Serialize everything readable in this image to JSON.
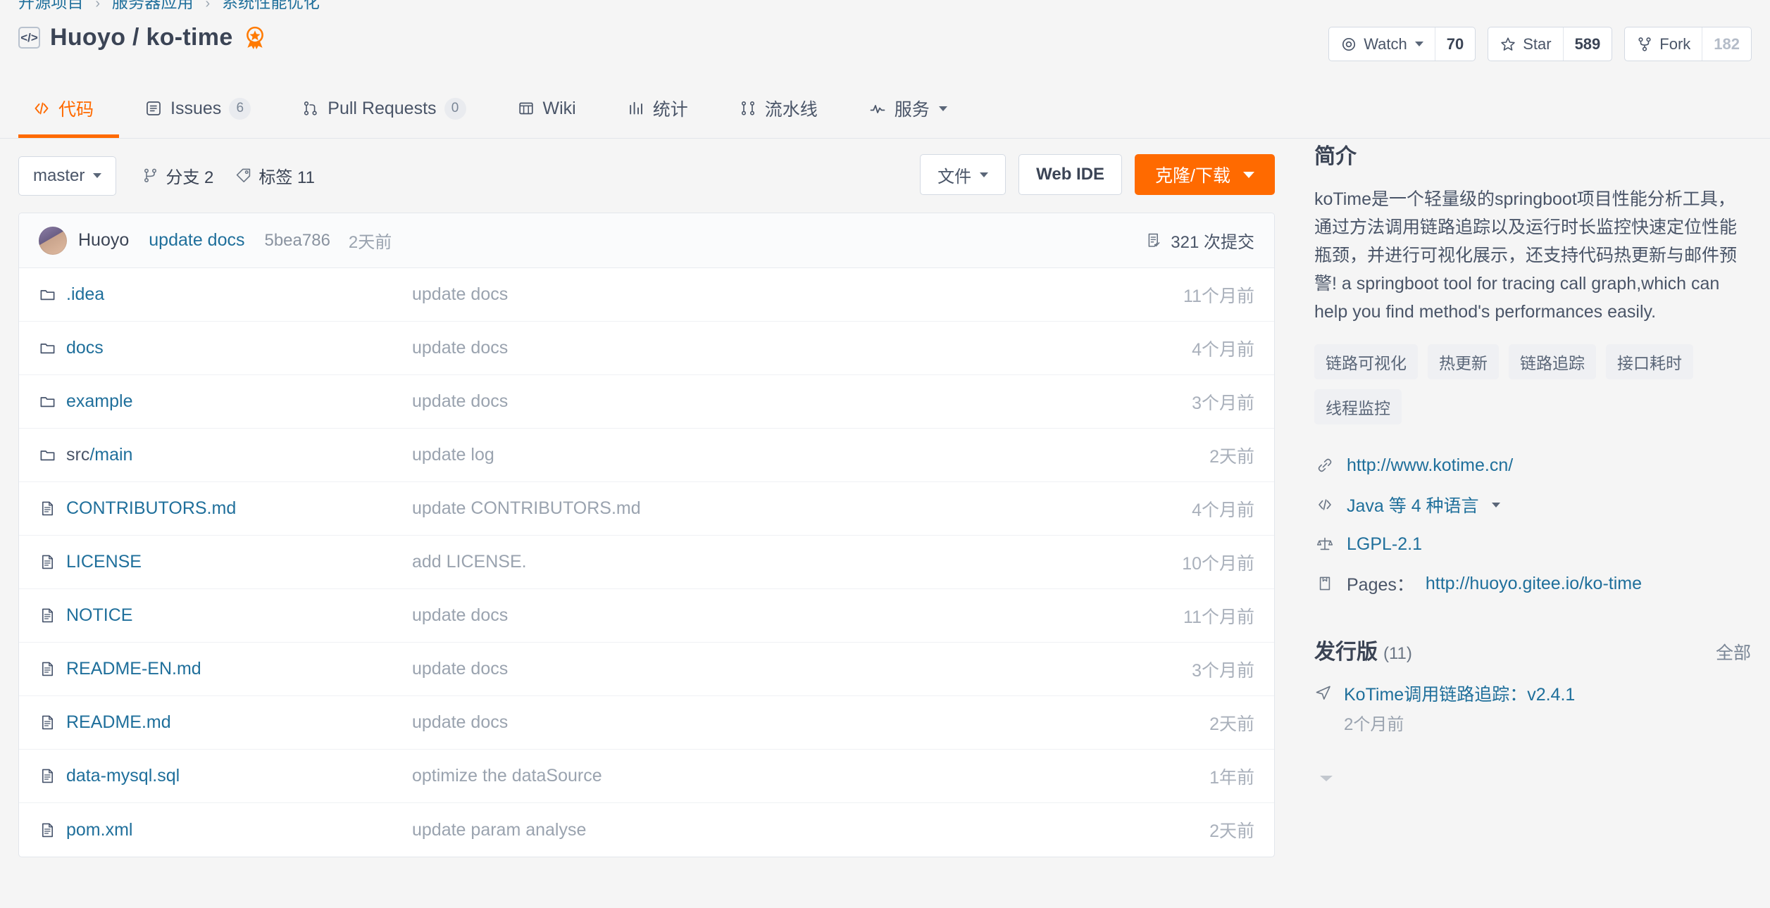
{
  "breadcrumb": {
    "items": [
      "开源项目",
      "服务器应用",
      "系统性能优化"
    ],
    "separator": "›"
  },
  "repo": {
    "owner": "Huoyo",
    "separator": "/",
    "name": "ko-time",
    "code_icon": "code-brackets-icon",
    "medal_icon": "gvp-medal-icon"
  },
  "counters": {
    "watch": {
      "label": "Watch",
      "value": "70",
      "icon": "eye-icon"
    },
    "star": {
      "label": "Star",
      "value": "589",
      "icon": "star-outline-icon"
    },
    "fork": {
      "label": "Fork",
      "value": "182",
      "icon": "fork-icon"
    }
  },
  "nav": {
    "tabs": [
      {
        "label": "代码",
        "icon": "code-icon",
        "badge": null,
        "active": true
      },
      {
        "label": "Issues",
        "icon": "issues-icon",
        "badge": "6",
        "active": false
      },
      {
        "label": "Pull Requests",
        "icon": "pr-icon",
        "badge": "0",
        "active": false
      },
      {
        "label": "Wiki",
        "icon": "book-icon",
        "badge": null,
        "active": false
      },
      {
        "label": "统计",
        "icon": "chart-icon",
        "badge": null,
        "active": false
      },
      {
        "label": "流水线",
        "icon": "pipeline-icon",
        "badge": null,
        "active": false
      },
      {
        "label": "服务",
        "icon": "service-icon",
        "badge": null,
        "active": false,
        "caret": true
      }
    ]
  },
  "toolbar": {
    "branch": "master",
    "branches_label": "分支 2",
    "tags_label": "标签 11",
    "branch_icon": "branch-icon",
    "tag_icon": "tag-icon",
    "files_btn": "文件",
    "webide_btn": "Web IDE",
    "clone_btn": "克隆/下载"
  },
  "commit_bar": {
    "author": "Huoyo",
    "message": "update docs",
    "sha": "5bea786",
    "when": "2天前",
    "commit_count": "321 次提交",
    "commit_icon": "commit-list-icon",
    "avatar_name": "avatar"
  },
  "files": [
    {
      "name": ".idea",
      "name_prefix": "",
      "type": "folder",
      "icon": "folder-icon",
      "message": "update docs",
      "time": "11个月前"
    },
    {
      "name": "docs",
      "name_prefix": "",
      "type": "folder",
      "icon": "folder-icon",
      "message": "update docs",
      "time": "4个月前"
    },
    {
      "name": "example",
      "name_prefix": "",
      "type": "folder",
      "icon": "folder-icon",
      "message": "update docs",
      "time": "3个月前"
    },
    {
      "name": "/main",
      "name_prefix": "src",
      "type": "folder",
      "icon": "folder-icon",
      "message": "update log",
      "time": "2天前"
    },
    {
      "name": "CONTRIBUTORS.md",
      "name_prefix": "",
      "type": "file",
      "icon": "document-icon",
      "message": "update CONTRIBUTORS.md",
      "time": "4个月前"
    },
    {
      "name": "LICENSE",
      "name_prefix": "",
      "type": "file",
      "icon": "document-icon",
      "message": "add LICENSE.",
      "time": "10个月前"
    },
    {
      "name": "NOTICE",
      "name_prefix": "",
      "type": "file",
      "icon": "document-icon",
      "message": "update docs",
      "time": "11个月前"
    },
    {
      "name": "README-EN.md",
      "name_prefix": "",
      "type": "file",
      "icon": "document-icon",
      "message": "update docs",
      "time": "3个月前"
    },
    {
      "name": "README.md",
      "name_prefix": "",
      "type": "file",
      "icon": "document-icon",
      "message": "update docs",
      "time": "2天前"
    },
    {
      "name": "data-mysql.sql",
      "name_prefix": "",
      "type": "file",
      "icon": "document-icon",
      "message": "optimize the dataSource",
      "time": "1年前"
    },
    {
      "name": "pom.xml",
      "name_prefix": "",
      "type": "file",
      "icon": "document-icon",
      "message": "update param analyse",
      "time": "2天前"
    }
  ],
  "sidebar": {
    "intro_heading": "简介",
    "description": "koTime是一个轻量级的springboot项目性能分析工具，通过方法调用链路追踪以及运行时长监控快速定位性能瓶颈，并进行可视化展示，还支持代码热更新与邮件预警! a springboot tool for tracing call graph,which can help you find method's performances easily.",
    "tags": [
      "链路可视化",
      "热更新",
      "链路追踪",
      "接口耗时",
      "线程监控"
    ],
    "homepage": {
      "url": "http://www.kotime.cn/",
      "icon": "link-icon"
    },
    "language": {
      "text": "Java 等 4 种语言",
      "icon": "code-brackets-icon",
      "caret": true
    },
    "license": {
      "text": "LGPL-2.1",
      "icon": "scale-icon"
    },
    "pages": {
      "label": "Pages：",
      "url": "http://huoyo.gitee.io/ko-time",
      "icon": "page-icon"
    },
    "releases": {
      "heading": "发行版",
      "count": "(11)",
      "all_label": "全部",
      "item": {
        "name": "KoTime调用链路追踪：v2.4.1",
        "when": "2个月前",
        "icon": "release-plane-icon"
      }
    }
  },
  "colors": {
    "accent_orange": "#FF6A00",
    "link_blue": "#1F6F9B",
    "text_dark": "#3B4455",
    "text_muted": "#9AA3AF",
    "page_bg": "#F5F5F5",
    "card_bg": "#FFFFFF"
  }
}
